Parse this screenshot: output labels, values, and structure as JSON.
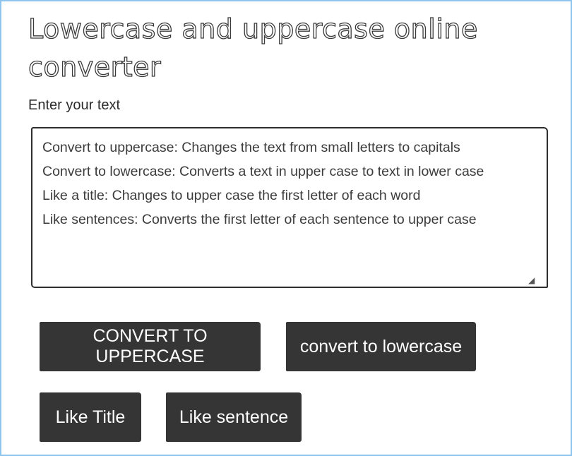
{
  "page": {
    "title": "Lowercase and uppercase online converter"
  },
  "form": {
    "label": "Enter your text",
    "text_value": "Convert to uppercase: Changes the text from small letters to capitals\nConvert to lowercase: Converts a text in upper case to text in lower case\nLike a title: Changes to upper case the first letter of each word\nLike sentences: Converts the first letter of each sentence to upper case"
  },
  "buttons": {
    "uppercase": "CONVERT TO UPPERCASE",
    "lowercase": "convert to lowercase",
    "title": "Like Title",
    "sentence": "Like sentence"
  },
  "colors": {
    "button_bg": "#353535",
    "frame_border": "#8ec5ee"
  }
}
